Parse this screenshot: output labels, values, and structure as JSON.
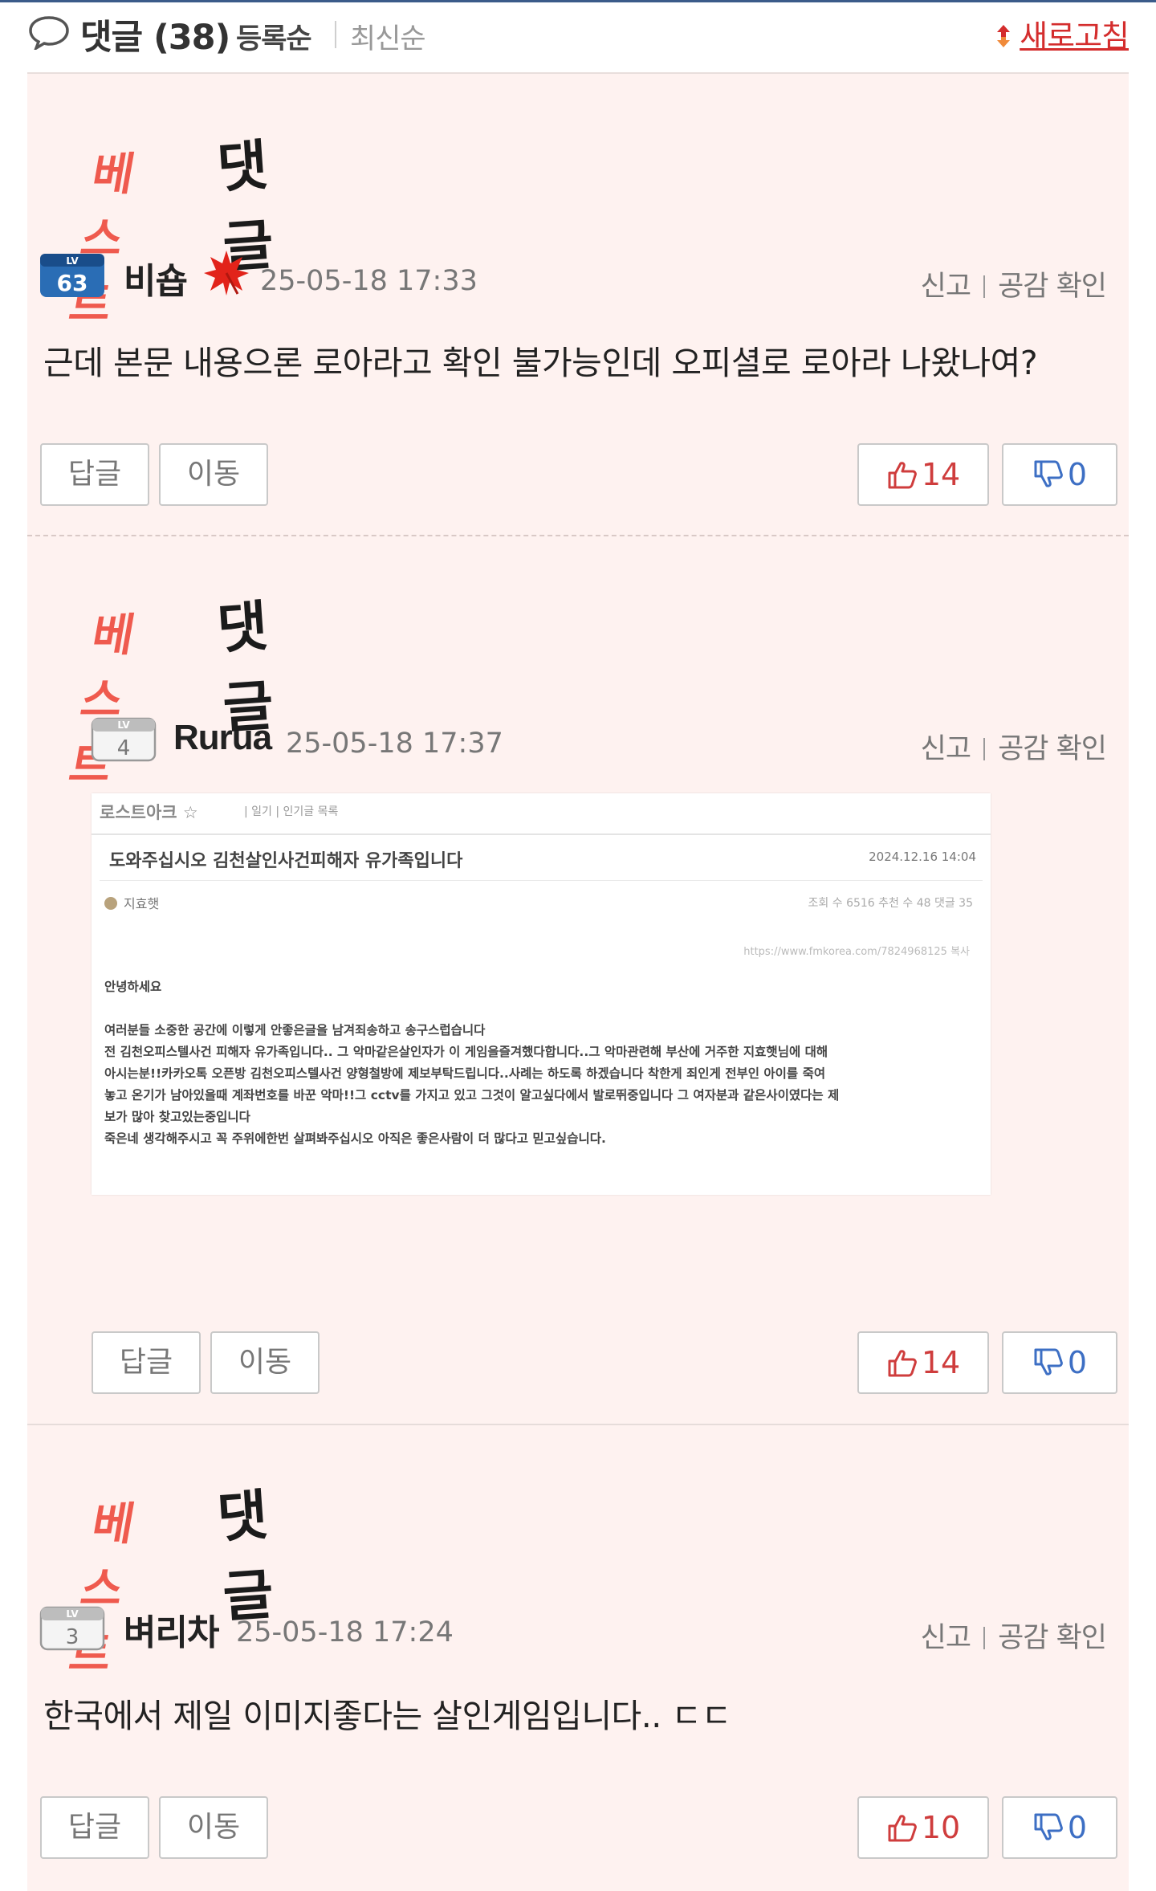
{
  "header": {
    "title": "댓글",
    "count": "(38)",
    "sort_active": "등록순",
    "sort_inactive": "최신순",
    "refresh_label": "새로고침"
  },
  "comments": [
    {
      "badge": "베스트 댓글",
      "badge_part1": "베스트",
      "badge_part2": "댓글",
      "level_label": "LV",
      "level": "63",
      "username": "비숍",
      "date": "25-05-18 17:33",
      "report": "신고",
      "check": "공감 확인",
      "text": "근데 본문 내용으론 로아라고 확인 불가능인데 오피셜로 로아라 나왔나여?",
      "reply_label": "답글",
      "move_label": "이동",
      "upvotes": "14",
      "downvotes": "0"
    },
    {
      "badge": "베스트 댓글",
      "badge_part1": "베스트",
      "badge_part2": "댓글",
      "level_label": "LV",
      "level": "4",
      "username": "Rurua",
      "date": "25-05-18 17:37",
      "report": "신고",
      "check": "공감 확인",
      "image": {
        "board": "로스트아크 ☆",
        "board_tabs": "| 일기 | 인기글 목록",
        "title": "도와주십시오 김천살인사건피해자 유가족입니다",
        "post_date": "2024.12.16 14:04",
        "author": "지효햇",
        "stats": "조회 수 6516   추천 수 48   댓글 35",
        "url": "https://www.fmkorea.com/7824968125  복사",
        "lines": [
          "안녕하세요",
          "",
          "여러분들 소중한 공간에 이렇게 안좋은글을 남겨죄송하고 송구스럽습니다",
          "전 김천오피스텔사건 피해자 유가족입니다.. 그 악마같은살인자가 이 게임을즐겨했다합니다..그 악마관련해 부산에 거주한 지효햇님에 대해",
          "아시는분!!카카오톡 오픈방 김천오피스텔사건 양형철방에 제보부탁드립니다..사례는 하도록 하겠습니다 착한게 죄인게 전부인 아이를 죽여",
          "놓고 온기가 남아있을때 계좌번호를 바꾼 악마!!그 cctv를 가지고 있고 그것이 알고싶다에서 발로뛰중입니다 그 여자분과 같은사이였다는 제",
          "보가 많아 찾고있는중입니다",
          "죽은네 생각해주시고 꼭 주위에한번 살펴봐주십시오 아직은 좋은사람이 더 많다고 믿고싶습니다."
        ]
      },
      "reply_label": "답글",
      "move_label": "이동",
      "upvotes": "14",
      "downvotes": "0"
    },
    {
      "badge": "베스트 댓글",
      "badge_part1": "베스트",
      "badge_part2": "댓글",
      "level_label": "LV",
      "level": "3",
      "username": "벼리차",
      "date": "25-05-18 17:24",
      "report": "신고",
      "check": "공감 확인",
      "text": "한국에서 제일 이미지좋다는 살인게임입니다.. ㄷㄷ",
      "reply_label": "답글",
      "move_label": "이동",
      "upvotes": "10",
      "downvotes": "0"
    }
  ],
  "colors": {
    "accent_red": "#d42d2d",
    "best_red": "#ef5a4e",
    "block_bg": "#fef2f0",
    "downvote_blue": "#3d6fc4",
    "level63_blue": "#2a6db5"
  },
  "icons": {
    "comment": "speech-bubble-icon",
    "refresh": "refresh-icon",
    "maple": "maple-leaf-icon",
    "thumb_up": "thumbs-up-icon",
    "thumb_down": "thumbs-down-icon"
  }
}
